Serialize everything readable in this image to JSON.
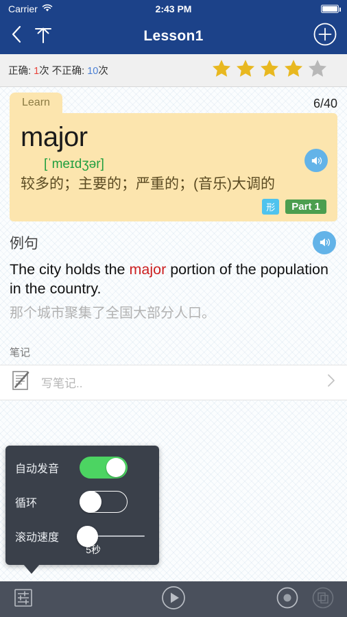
{
  "status_bar": {
    "carrier": "Carrier",
    "wifi_icon": "wifi-icon",
    "time": "2:43 PM",
    "battery_icon": "battery-full-icon"
  },
  "nav_bar": {
    "back_icon": "back-chevron-icon",
    "up_icon": "upload-arrow-icon",
    "title": "Lesson1",
    "add_icon": "add-circle-icon"
  },
  "stats": {
    "correct_label": "正确: ",
    "correct_count": "1",
    "correct_unit": "次",
    "incorrect_label": " 不正确: ",
    "incorrect_count": "10",
    "incorrect_unit": "次",
    "stars_filled": 4,
    "stars_total": 5,
    "star_color": "#e8b820",
    "star_empty_color": "#b8b8b8"
  },
  "card": {
    "tab_label": "Learn",
    "counter": "6/40",
    "word": "major",
    "phonetic": "[ˈmeɪdʒər]",
    "definition": "较多的；主要的；严重的；(音乐)大调的",
    "pos_badge": "形",
    "part_badge": "Part 1",
    "speaker_icon": "speaker-icon",
    "bg_color": "#fce5ae"
  },
  "example": {
    "heading": "例句",
    "speaker_icon": "speaker-icon",
    "en_before": "The city holds the ",
    "en_highlight": "major",
    "en_after": " portion of the population in the country.",
    "cn": "那个城市聚集了全国大部分人口。",
    "highlight_color": "#cc1f20"
  },
  "notes": {
    "heading": "笔记",
    "note_icon": "note-pencil-icon",
    "placeholder": "写笔记..",
    "chevron_icon": "chevron-right-icon"
  },
  "settings_popover": {
    "rows": [
      {
        "label": "自动发音",
        "control": "toggle",
        "state": "on"
      },
      {
        "label": "循环",
        "control": "toggle",
        "state": "off"
      },
      {
        "label": "滚动速度",
        "control": "slider",
        "value": "5秒"
      }
    ],
    "speed_value": "5秒",
    "on_color": "#4cd462",
    "bg_color": "#3a404a"
  },
  "toolbar": {
    "settings_icon": "sliders-settings-icon",
    "play_icon": "play-icon",
    "record_icon": "record-icon",
    "cards_icon": "card-stack-icon"
  }
}
